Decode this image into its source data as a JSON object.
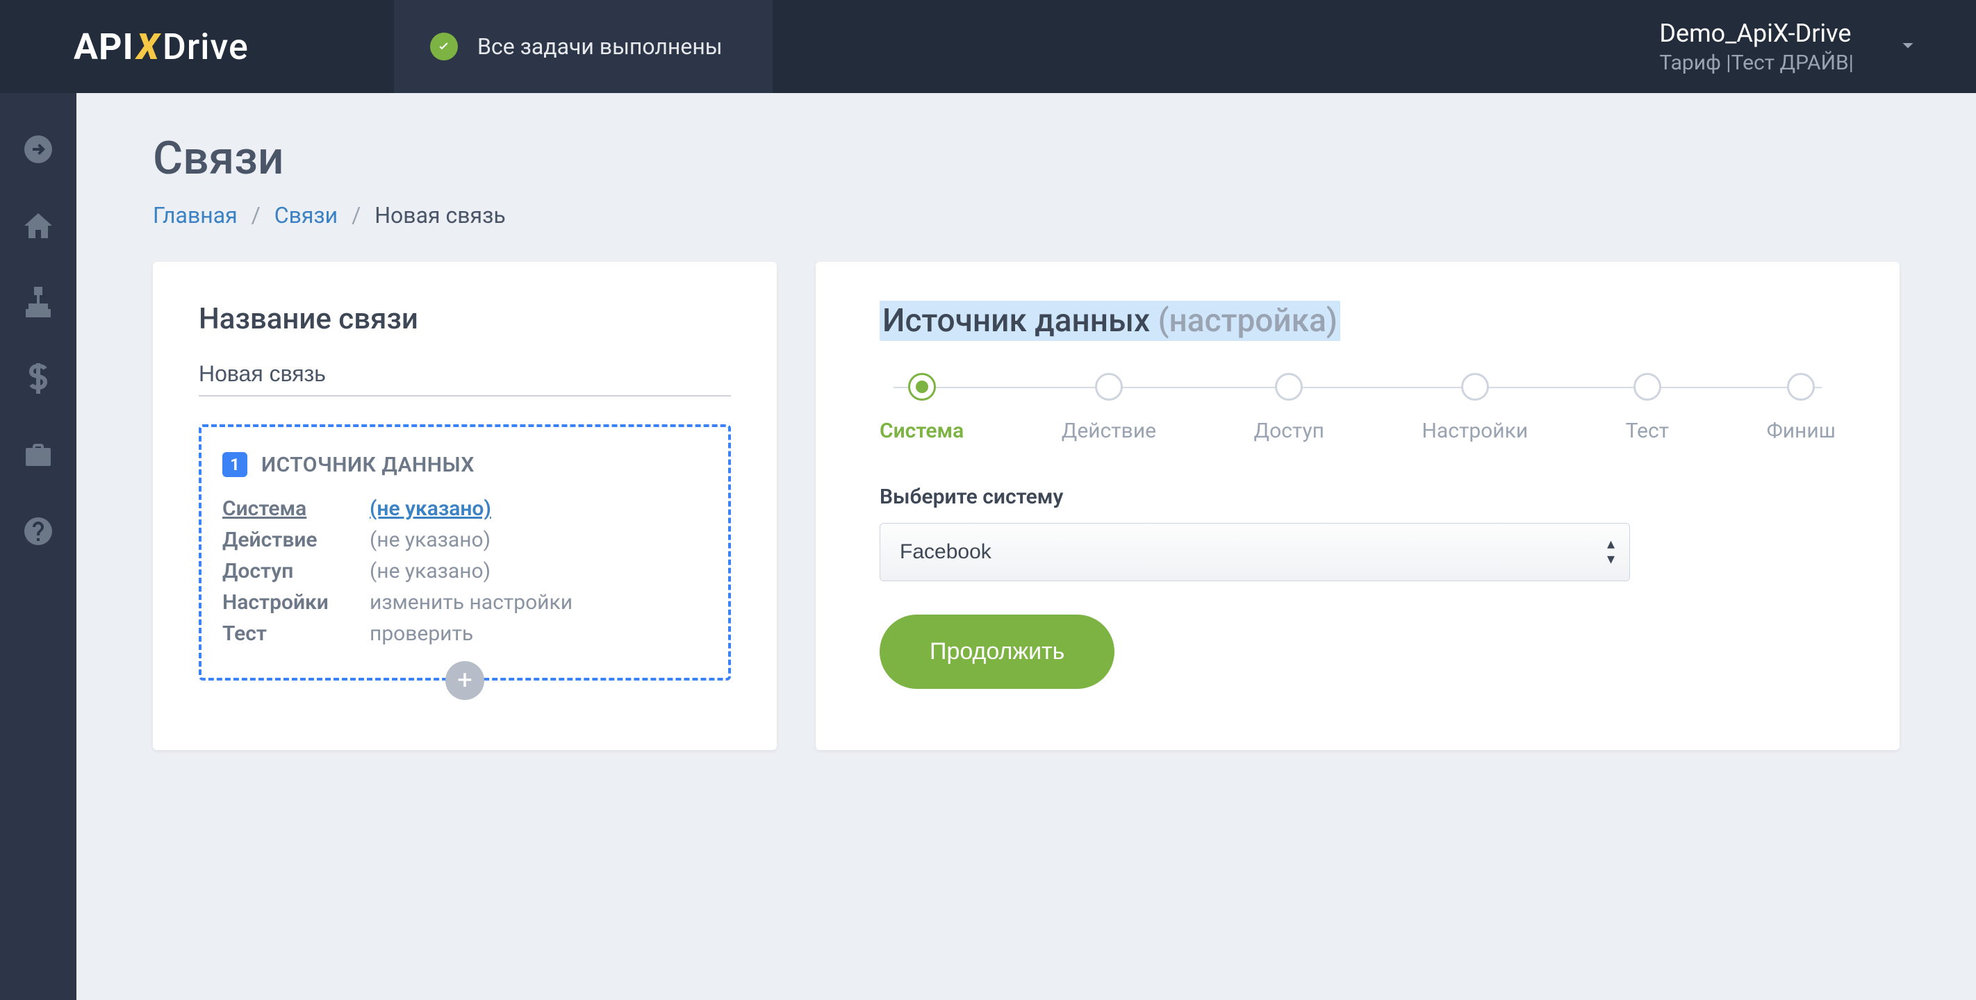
{
  "header": {
    "logo_api": "API",
    "logo_x": "X",
    "logo_drive": "Drive",
    "status_text": "Все задачи выполнены",
    "account_name": "Demo_ApiX-Drive",
    "account_tariff": "Тариф |Тест ДРАЙВ|"
  },
  "sidebar": {
    "items": [
      {
        "name": "arrow-right-circle-icon"
      },
      {
        "name": "home-icon"
      },
      {
        "name": "sitemap-icon"
      },
      {
        "name": "dollar-icon"
      },
      {
        "name": "briefcase-icon"
      },
      {
        "name": "help-icon"
      }
    ]
  },
  "page": {
    "title": "Связи",
    "breadcrumb": {
      "home": "Главная",
      "links": "Связи",
      "current": "Новая связь"
    }
  },
  "left": {
    "title": "Название связи",
    "name_value": "Новая связь",
    "source_badge": "1",
    "source_title": "ИСТОЧНИК ДАННЫХ",
    "rows": [
      {
        "label": "Система",
        "value": "(не указано)",
        "active": true
      },
      {
        "label": "Действие",
        "value": "(не указано)",
        "active": false
      },
      {
        "label": "Доступ",
        "value": "(не указано)",
        "active": false
      },
      {
        "label": "Настройки",
        "value": "изменить настройки",
        "active": false
      },
      {
        "label": "Тест",
        "value": "проверить",
        "active": false
      }
    ],
    "add_symbol": "+"
  },
  "right": {
    "title_main": "Источник данных",
    "title_muted": "(настройка)",
    "steps": [
      {
        "label": "Система",
        "active": true
      },
      {
        "label": "Действие",
        "active": false
      },
      {
        "label": "Доступ",
        "active": false
      },
      {
        "label": "Настройки",
        "active": false
      },
      {
        "label": "Тест",
        "active": false
      },
      {
        "label": "Финиш",
        "active": false
      }
    ],
    "field_label": "Выберите систему",
    "select_value": "Facebook",
    "continue_label": "Продолжить"
  }
}
